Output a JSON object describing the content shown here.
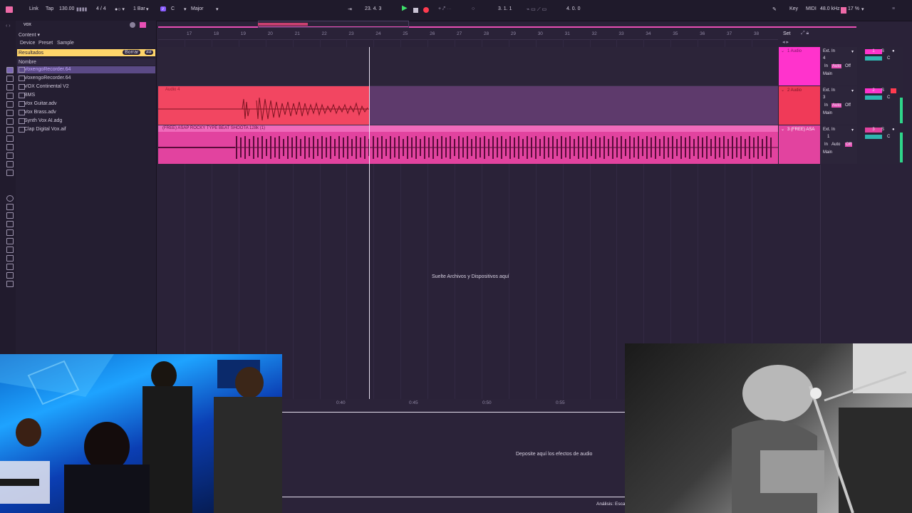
{
  "topbar": {
    "link": "Link",
    "tap": "Tap",
    "tempo": "130.00",
    "time_sig": "4 / 4",
    "quantize": "1 Bar",
    "key_root": "C",
    "scale": "Major",
    "position": "23.  4.  3",
    "loop_start": "3.  1.  1",
    "loop_length": "4.  0.  0",
    "key_label": "Key",
    "midi_label": "MIDI",
    "sample_rate": "48.0 kHz",
    "cpu": "17 %"
  },
  "browser": {
    "search_value": "vox",
    "content_label": "Content",
    "filters": [
      "Device",
      "Preset",
      "Sample"
    ],
    "results_label": "Resultados",
    "clear_label": "Borrar",
    "name_header": "Nombre",
    "items": [
      "VoxengoRecorder.64",
      "VoxengoRecorder.64",
      "VOX Continental V2",
      "BMS",
      "Vox Guitar.adv",
      "Vox Brass.adv",
      "Synth Vox AI.adg",
      "Clap Digital Vox.aif"
    ]
  },
  "ruler": {
    "bars": [
      "17",
      "18",
      "19",
      "20",
      "21",
      "22",
      "23",
      "24",
      "25",
      "26",
      "27",
      "28",
      "29",
      "30",
      "31",
      "32",
      "33",
      "34",
      "35",
      "36",
      "37",
      "38"
    ],
    "set_label": "Set"
  },
  "tracks": [
    {
      "name": "1 Audio",
      "color": "#ff33cc",
      "input": "Ext. In",
      "channel": "4",
      "in": "In",
      "auto": "Auto",
      "off": "Off",
      "out": "Main",
      "num": "1",
      "s": "S",
      "c": "C"
    },
    {
      "name": "2 Audio",
      "color": "#f03a58",
      "input": "Ext. In",
      "channel": "3",
      "in": "In",
      "auto": "Auto",
      "off": "Off",
      "out": "Main",
      "num": "2",
      "s": "S",
      "c": "C",
      "clip": "Audio 4"
    },
    {
      "name": "3 (FREE)  ASA",
      "color": "#e2439f",
      "input": "Ext. In",
      "channel": "1",
      "in": "In",
      "auto": "Auto",
      "off": "Off",
      "out": "Main",
      "num": "3",
      "s": "S",
      "c": "C",
      "clip": "(FREE)  ASAP  ROCKY  TYPE  BEAT  SHOOTA  128k (1)"
    }
  ],
  "arrange": {
    "drop_hint": "Suelte Archivos y Dispositivos aquí"
  },
  "detail": {
    "times": [
      "0:40",
      "0:45",
      "0:50",
      "0:55"
    ],
    "fx_hint": "Deposite aquí los efectos de audio",
    "status": "Análisis: Esca"
  },
  "colors": {
    "accent": "#ff33cc",
    "clip_red": "#f03a58",
    "clip_pink": "#e2439f",
    "play": "#3ee06a",
    "record": "#ff3b4f"
  }
}
